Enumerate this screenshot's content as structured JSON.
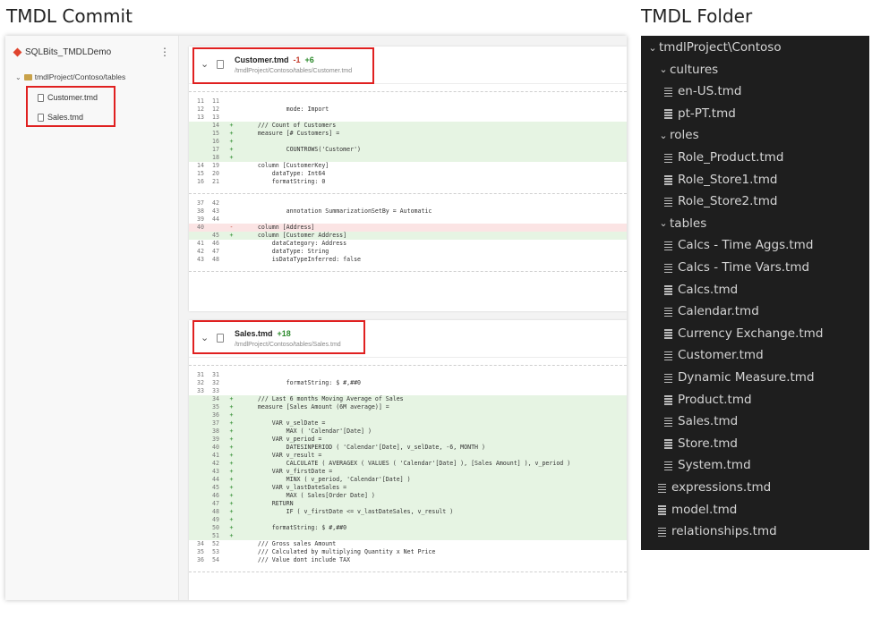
{
  "headings": {
    "left": "TMDL Commit",
    "right": "TMDL Folder"
  },
  "commit": {
    "repo_name": "SQLBits_TMDLDemo",
    "more_icon": "⋮",
    "folder_path": "tmdlProject/Contoso/tables",
    "files": [
      "Customer.tmd",
      "Sales.tmd"
    ],
    "diffs": [
      {
        "file": "Customer.tmd",
        "stat_del": "-1",
        "stat_add": "+6",
        "path": "/tmdlProject/Contoso/tables/Customer.tmd",
        "hunks": [
          [
            {
              "o": "11",
              "n": "11",
              "s": "",
              "t": "",
              "k": "ctx"
            },
            {
              "o": "12",
              "n": "12",
              "s": "",
              "t": "            mode: Import",
              "k": "ctx"
            },
            {
              "o": "13",
              "n": "13",
              "s": "",
              "t": "",
              "k": "ctx"
            },
            {
              "o": "",
              "n": "14",
              "s": "+",
              "t": "    /// Count of Customers",
              "k": "add"
            },
            {
              "o": "",
              "n": "15",
              "s": "+",
              "t": "    measure [# Customers] =",
              "k": "add"
            },
            {
              "o": "",
              "n": "16",
              "s": "+",
              "t": "",
              "k": "add"
            },
            {
              "o": "",
              "n": "17",
              "s": "+",
              "t": "            COUNTROWS('Customer')",
              "k": "add"
            },
            {
              "o": "",
              "n": "18",
              "s": "+",
              "t": "",
              "k": "add"
            },
            {
              "o": "14",
              "n": "19",
              "s": "",
              "t": "    column [CustomerKey]",
              "k": "ctx"
            },
            {
              "o": "15",
              "n": "20",
              "s": "",
              "t": "        dataType: Int64",
              "k": "ctx"
            },
            {
              "o": "16",
              "n": "21",
              "s": "",
              "t": "        formatString: 0",
              "k": "ctx"
            }
          ],
          [
            {
              "o": "37",
              "n": "42",
              "s": "",
              "t": "",
              "k": "ctx"
            },
            {
              "o": "38",
              "n": "43",
              "s": "",
              "t": "            annotation SummarizationSetBy = Automatic",
              "k": "ctx"
            },
            {
              "o": "39",
              "n": "44",
              "s": "",
              "t": "",
              "k": "ctx"
            },
            {
              "o": "40",
              "n": "",
              "s": "-",
              "t": "    column [Address]",
              "k": "del"
            },
            {
              "o": "",
              "n": "45",
              "s": "+",
              "t": "    column [Customer Address]",
              "k": "add"
            },
            {
              "o": "41",
              "n": "46",
              "s": "",
              "t": "        dataCategory: Address",
              "k": "ctx"
            },
            {
              "o": "42",
              "n": "47",
              "s": "",
              "t": "        dataType: String",
              "k": "ctx"
            },
            {
              "o": "43",
              "n": "48",
              "s": "",
              "t": "        isDataTypeInferred: false",
              "k": "ctx"
            }
          ]
        ]
      },
      {
        "file": "Sales.tmd",
        "stat_del": "",
        "stat_add": "+18",
        "path": "/tmdlProject/Contoso/tables/Sales.tmd",
        "hunks": [
          [
            {
              "o": "31",
              "n": "31",
              "s": "",
              "t": "",
              "k": "ctx"
            },
            {
              "o": "32",
              "n": "32",
              "s": "",
              "t": "            formatString: $ #,##0",
              "k": "ctx"
            },
            {
              "o": "33",
              "n": "33",
              "s": "",
              "t": "",
              "k": "ctx"
            },
            {
              "o": "",
              "n": "34",
              "s": "+",
              "t": "    /// Last 6 months Moving Average of Sales",
              "k": "add"
            },
            {
              "o": "",
              "n": "35",
              "s": "+",
              "t": "    measure [Sales Amount (6M average)] =",
              "k": "add"
            },
            {
              "o": "",
              "n": "36",
              "s": "+",
              "t": "",
              "k": "add"
            },
            {
              "o": "",
              "n": "37",
              "s": "+",
              "t": "        VAR v_selDate =",
              "k": "add"
            },
            {
              "o": "",
              "n": "38",
              "s": "+",
              "t": "            MAX ( 'Calendar'[Date] )",
              "k": "add"
            },
            {
              "o": "",
              "n": "39",
              "s": "+",
              "t": "        VAR v_period =",
              "k": "add"
            },
            {
              "o": "",
              "n": "40",
              "s": "+",
              "t": "            DATESINPERIOD ( 'Calendar'[Date], v_selDate, -6, MONTH )",
              "k": "add"
            },
            {
              "o": "",
              "n": "41",
              "s": "+",
              "t": "        VAR v_result =",
              "k": "add"
            },
            {
              "o": "",
              "n": "42",
              "s": "+",
              "t": "            CALCULATE ( AVERAGEX ( VALUES ( 'Calendar'[Date] ), [Sales Amount] ), v_period )",
              "k": "add"
            },
            {
              "o": "",
              "n": "43",
              "s": "+",
              "t": "        VAR v_firstDate =",
              "k": "add"
            },
            {
              "o": "",
              "n": "44",
              "s": "+",
              "t": "            MINX ( v_period, 'Calendar'[Date] )",
              "k": "add"
            },
            {
              "o": "",
              "n": "45",
              "s": "+",
              "t": "        VAR v_lastDateSales =",
              "k": "add"
            },
            {
              "o": "",
              "n": "46",
              "s": "+",
              "t": "            MAX ( Sales[Order Date] )",
              "k": "add"
            },
            {
              "o": "",
              "n": "47",
              "s": "+",
              "t": "        RETURN",
              "k": "add"
            },
            {
              "o": "",
              "n": "48",
              "s": "+",
              "t": "            IF ( v_firstDate <= v_lastDateSales, v_result )",
              "k": "add"
            },
            {
              "o": "",
              "n": "49",
              "s": "+",
              "t": "",
              "k": "add"
            },
            {
              "o": "",
              "n": "50",
              "s": "+",
              "t": "        formatString: $ #,##0",
              "k": "add"
            },
            {
              "o": "",
              "n": "51",
              "s": "+",
              "t": "",
              "k": "add"
            },
            {
              "o": "34",
              "n": "52",
              "s": "",
              "t": "    /// Gross sales Amount",
              "k": "ctx"
            },
            {
              "o": "35",
              "n": "53",
              "s": "",
              "t": "    /// Calculated by multiplying Quantity x Net Price",
              "k": "ctx"
            },
            {
              "o": "36",
              "n": "54",
              "s": "",
              "t": "    /// Value dont include TAX",
              "k": "ctx"
            }
          ]
        ]
      }
    ]
  },
  "folder": {
    "chevron_open": "⌄",
    "rows": [
      {
        "label": "tmdlProject\\Contoso",
        "type": "folder",
        "depth": 0
      },
      {
        "label": "cultures",
        "type": "folder",
        "depth": 1
      },
      {
        "label": "en-US.tmd",
        "type": "file",
        "depth": 2
      },
      {
        "label": "pt-PT.tmd",
        "type": "file",
        "depth": 2
      },
      {
        "label": "roles",
        "type": "folder",
        "depth": 1
      },
      {
        "label": "Role_Product.tmd",
        "type": "file",
        "depth": 2
      },
      {
        "label": "Role_Store1.tmd",
        "type": "file",
        "depth": 2
      },
      {
        "label": "Role_Store2.tmd",
        "type": "file",
        "depth": 2
      },
      {
        "label": "tables",
        "type": "folder",
        "depth": 1
      },
      {
        "label": "Calcs - Time Aggs.tmd",
        "type": "file",
        "depth": 2
      },
      {
        "label": "Calcs - Time Vars.tmd",
        "type": "file",
        "depth": 2
      },
      {
        "label": "Calcs.tmd",
        "type": "file",
        "depth": 2
      },
      {
        "label": "Calendar.tmd",
        "type": "file",
        "depth": 2
      },
      {
        "label": "Currency Exchange.tmd",
        "type": "file",
        "depth": 2
      },
      {
        "label": "Customer.tmd",
        "type": "file",
        "depth": 2
      },
      {
        "label": "Dynamic Measure.tmd",
        "type": "file",
        "depth": 2
      },
      {
        "label": "Product.tmd",
        "type": "file",
        "depth": 2
      },
      {
        "label": "Sales.tmd",
        "type": "file",
        "depth": 2
      },
      {
        "label": "Store.tmd",
        "type": "file",
        "depth": 2
      },
      {
        "label": "System.tmd",
        "type": "file",
        "depth": 2
      },
      {
        "label": "expressions.tmd",
        "type": "file",
        "depth": 1
      },
      {
        "label": "model.tmd",
        "type": "file",
        "depth": 1
      },
      {
        "label": "relationships.tmd",
        "type": "file",
        "depth": 1
      }
    ]
  },
  "colors": {
    "highlight_box": "#e02020",
    "added_bg": "#e6f4e3",
    "removed_bg": "#fbe4e4",
    "folder_bg": "#1e1e1e"
  }
}
